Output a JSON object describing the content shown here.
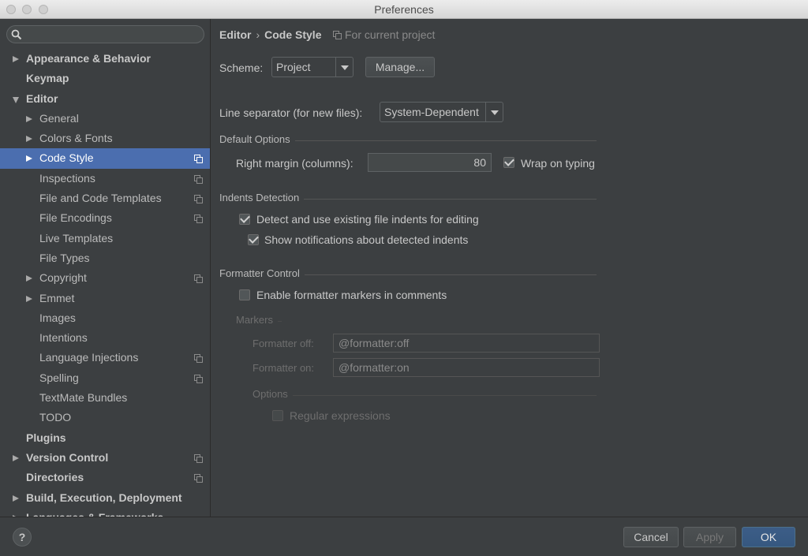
{
  "window": {
    "title": "Preferences"
  },
  "sidebar": {
    "search_placeholder": "",
    "items": [
      {
        "label": "Appearance & Behavior",
        "bold": true,
        "level": 0,
        "arrow": "right"
      },
      {
        "label": "Keymap",
        "bold": true,
        "level": 0,
        "arrow": ""
      },
      {
        "label": "Editor",
        "bold": true,
        "level": 0,
        "arrow": "down"
      },
      {
        "label": "General",
        "bold": false,
        "level": 1,
        "arrow": "right"
      },
      {
        "label": "Colors & Fonts",
        "bold": false,
        "level": 1,
        "arrow": "right"
      },
      {
        "label": "Code Style",
        "bold": false,
        "level": 1,
        "arrow": "right",
        "selected": true,
        "project_icon": true
      },
      {
        "label": "Inspections",
        "bold": false,
        "level": 1,
        "arrow": "",
        "project_icon": true
      },
      {
        "label": "File and Code Templates",
        "bold": false,
        "level": 1,
        "arrow": "",
        "project_icon": true
      },
      {
        "label": "File Encodings",
        "bold": false,
        "level": 1,
        "arrow": "",
        "project_icon": true
      },
      {
        "label": "Live Templates",
        "bold": false,
        "level": 1,
        "arrow": ""
      },
      {
        "label": "File Types",
        "bold": false,
        "level": 1,
        "arrow": ""
      },
      {
        "label": "Copyright",
        "bold": false,
        "level": 1,
        "arrow": "right",
        "project_icon": true
      },
      {
        "label": "Emmet",
        "bold": false,
        "level": 1,
        "arrow": "right"
      },
      {
        "label": "Images",
        "bold": false,
        "level": 1,
        "arrow": ""
      },
      {
        "label": "Intentions",
        "bold": false,
        "level": 1,
        "arrow": ""
      },
      {
        "label": "Language Injections",
        "bold": false,
        "level": 1,
        "arrow": "",
        "project_icon": true
      },
      {
        "label": "Spelling",
        "bold": false,
        "level": 1,
        "arrow": "",
        "project_icon": true
      },
      {
        "label": "TextMate Bundles",
        "bold": false,
        "level": 1,
        "arrow": ""
      },
      {
        "label": "TODO",
        "bold": false,
        "level": 1,
        "arrow": ""
      },
      {
        "label": "Plugins",
        "bold": true,
        "level": 0,
        "arrow": ""
      },
      {
        "label": "Version Control",
        "bold": true,
        "level": 0,
        "arrow": "right",
        "project_icon": true
      },
      {
        "label": "Directories",
        "bold": true,
        "level": 0,
        "arrow": "",
        "project_icon": true
      },
      {
        "label": "Build, Execution, Deployment",
        "bold": true,
        "level": 0,
        "arrow": "right"
      },
      {
        "label": "Languages & Frameworks",
        "bold": true,
        "level": 0,
        "arrow": "right"
      }
    ]
  },
  "header": {
    "breadcrumb_parent": "Editor",
    "breadcrumb_separator": "›",
    "breadcrumb_current": "Code Style",
    "scope_note": "For current project"
  },
  "scheme": {
    "label": "Scheme:",
    "value": "Project",
    "manage_label": "Manage..."
  },
  "line_separator": {
    "label": "Line separator (for new files):",
    "value": "System-Dependent"
  },
  "default_options": {
    "title": "Default Options",
    "right_margin_label": "Right margin (columns):",
    "right_margin_value": "80",
    "wrap_on_typing_label": "Wrap on typing",
    "wrap_on_typing_checked": true
  },
  "indents_detection": {
    "title": "Indents Detection",
    "detect_label": "Detect and use existing file indents for editing",
    "detect_checked": true,
    "notify_label": "Show notifications about detected indents",
    "notify_checked": true
  },
  "formatter_control": {
    "title": "Formatter Control",
    "enable_label": "Enable formatter markers in comments",
    "enable_checked": false,
    "markers_title": "Markers",
    "off_label": "Formatter off:",
    "off_value": "@formatter:off",
    "on_label": "Formatter on:",
    "on_value": "@formatter:on",
    "options_title": "Options",
    "regex_label": "Regular expressions",
    "regex_checked": false
  },
  "footer": {
    "help_label": "?",
    "cancel_label": "Cancel",
    "apply_label": "Apply",
    "ok_label": "OK"
  },
  "colors": {
    "selection": "#4b6eaf",
    "background": "#3c3f41",
    "default_button": "#365880"
  }
}
